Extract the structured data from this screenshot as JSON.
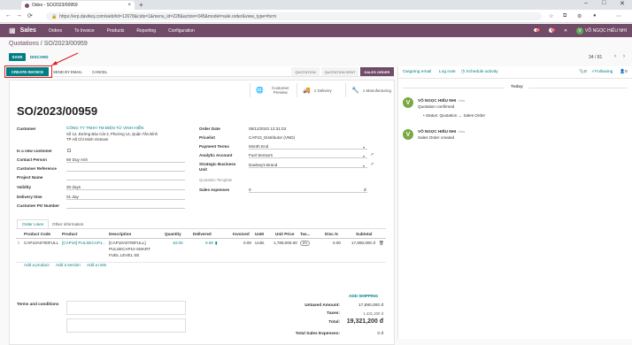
{
  "browser": {
    "tab_title": "Odoo - SO/2023/00959",
    "url": "https://erp.daviteq.com/web#id=12678&cids=1&menu_id=228&action=345&model=sale.order&view_type=form",
    "new_tab": "+",
    "tab_close": "×"
  },
  "navbar": {
    "app_name": "Sales",
    "menu": [
      "Orders",
      "To Invoice",
      "Products",
      "Reporting",
      "Configuration"
    ],
    "chat_badge": "5",
    "activity_badge": "6",
    "user_initial": "V",
    "user_name": "VÕ NGỌC HIẾU NHI"
  },
  "breadcrumb": {
    "parent": "Quotations",
    "sep": " / ",
    "current": "SO/2023/00959"
  },
  "control": {
    "save": "SAVE",
    "discard": "DISCARD",
    "pager": "34 / 81"
  },
  "statusbar": {
    "create_invoice": "CREATE INVOICE",
    "send_email": "SEND BY EMAIL",
    "cancel": "CANCEL",
    "stages": [
      "QUOTATION",
      "QUOTATION SENT",
      "SALES ORDER"
    ],
    "active_stage": "SALES ORDER"
  },
  "smart_buttons": [
    {
      "icon": "globe-icon",
      "label": "Customer Preview"
    },
    {
      "icon": "truck-icon",
      "label": "1 Delivery"
    },
    {
      "icon": "wrench-icon",
      "label": "1 Manufacturing"
    }
  ],
  "form": {
    "name": "SO/2023/00959",
    "customer_label": "Customer",
    "customer_name": "CÔNG TY TNHH TM ĐIỆN TỬ VINH HIỂN",
    "customer_addr1": "Số 12, Đường Bàu Cát 3, Phường 14, Quận Tân Bình",
    "customer_addr2": "TP Hồ Chí Minh Vietnam",
    "new_customer_label": "Is a new customer",
    "contact_label": "Contact Person",
    "contact": "Mr Duy Anh",
    "cust_ref_label": "Customer Reference",
    "project_label": "Project Name",
    "validity_label": "Validity",
    "validity": "30 days",
    "delivery_label": "Delivery time",
    "delivery": "01 day",
    "po_label": "Customer PO Number",
    "order_date_label": "Order Date",
    "order_date": "08/12/2023 12:31:03",
    "pricelist_label": "Pricelist",
    "pricelist": "CAP10_Distributor (VND)",
    "payment_label": "Payment Terms",
    "payment": "Month End",
    "analytic_label": "Analytic Account",
    "analytic": "Fuel Sensors",
    "brand_label": "Strategic Business Unit",
    "brand": "Daviteq's Brand",
    "template_placeholder": "Quotation Template",
    "sales_exp_label": "Sales expenses",
    "sales_exp": "0",
    "currency": "đ"
  },
  "notebook": {
    "tabs": [
      "Order Lines",
      "Other information"
    ]
  },
  "lines": {
    "headers": [
      "Product Code",
      "Product",
      "Description",
      "Quantity",
      "Delivered",
      "Invoiced",
      "UoM",
      "Unit Price",
      "Tax...",
      "Disc.%",
      "Subtotal"
    ],
    "row": {
      "code": "CAP10A0700FULL",
      "product": "[CAP10] PULSECAP1...",
      "desc1": "[CAP10A0700FULL]",
      "desc2": "PULSECAP10 SMART",
      "desc3": "FUEL LEVEL SE",
      "qty": "10.00",
      "delivered": "0.00",
      "invoiced": "0.00",
      "uom": "Units",
      "price": "1,789,000.00",
      "tax": "8%",
      "disc": "0.00",
      "subtotal": "17,890,000 đ"
    },
    "add_product": "Add a product",
    "add_section": "Add a section",
    "add_note": "Add a note",
    "add_shipping": "ADD SHIPPING"
  },
  "totals": {
    "terms_label": "Terms and conditions",
    "untaxed_label": "Untaxed Amount:",
    "untaxed": "17,890,000 đ",
    "taxes_label": "Taxes:",
    "taxes": "1,431,200 đ",
    "total_label": "Total:",
    "total": "19,321,200 đ",
    "expenses_label": "Total Sales Expenses:",
    "expenses": "0 đ"
  },
  "chatter": {
    "outgoing": "Outgoing email",
    "lognote": "Log note",
    "schedule": "Schedule activity",
    "attach_count": "0",
    "following": "Following",
    "followers": "0",
    "today": "Today",
    "messages": [
      {
        "initial": "V",
        "author": "VÕ NGỌC HIẾU NHI",
        "time": "- Now",
        "text": "Quotation confirmed",
        "tracking": "Status: Quotation → Sales Order"
      },
      {
        "initial": "V",
        "author": "VÕ NGỌC HIẾU NHI",
        "time": "- Now",
        "text": "Sales Order created",
        "tracking": ""
      }
    ]
  },
  "colors": {
    "brand": "#714b67",
    "primary": "#017e84",
    "highlight": "#e02020"
  }
}
